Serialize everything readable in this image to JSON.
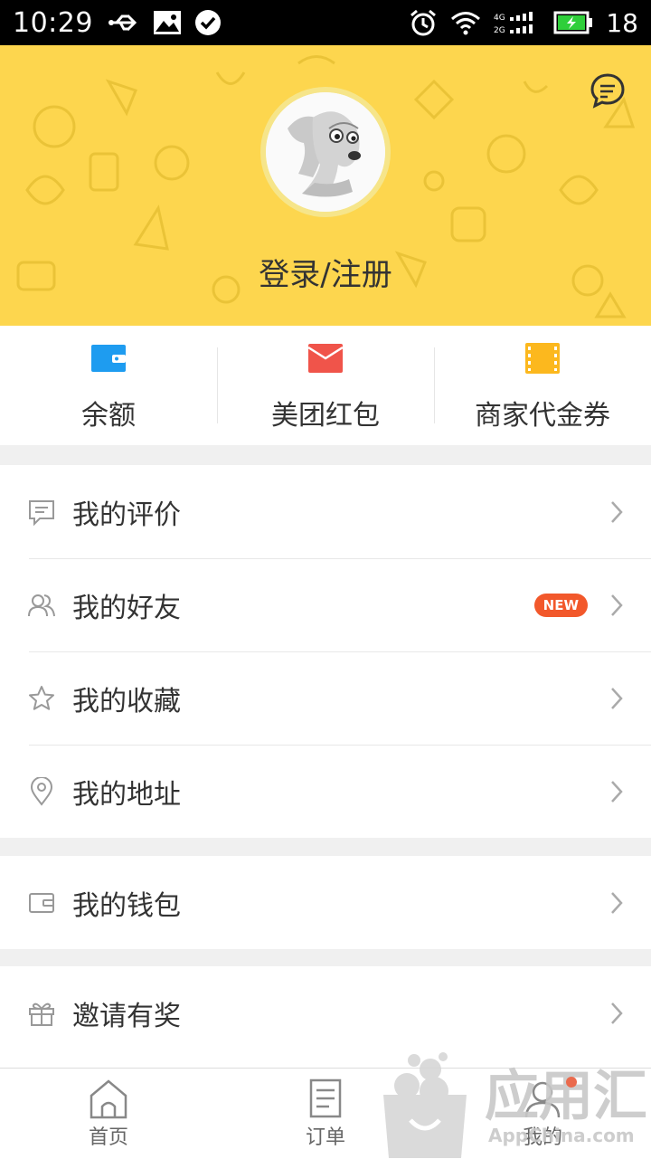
{
  "status_bar": {
    "time": "10:29",
    "battery_level": "18",
    "left_icons": [
      "usb-icon",
      "image-icon",
      "check-circle-icon"
    ],
    "right_icons": [
      "alarm-icon",
      "wifi-icon",
      "signal-icon",
      "battery-icon"
    ]
  },
  "header": {
    "login_label": "登录/注册",
    "background_color": "#fdd64e",
    "message_icon": "message-icon"
  },
  "quick_actions": [
    {
      "label": "余额",
      "icon": "wallet-icon",
      "color": "#1e9cf0"
    },
    {
      "label": "美团红包",
      "icon": "red-envelope-icon",
      "color": "#f0544a"
    },
    {
      "label": "商家代金券",
      "icon": "ticket-icon",
      "color": "#fcb81e"
    }
  ],
  "menu_groups": [
    {
      "items": [
        {
          "label": "我的评价",
          "icon": "comment-icon"
        },
        {
          "label": "我的好友",
          "icon": "friends-icon",
          "badge": "NEW"
        },
        {
          "label": "我的收藏",
          "icon": "star-icon"
        },
        {
          "label": "我的地址",
          "icon": "location-pin-icon"
        }
      ]
    },
    {
      "items": [
        {
          "label": "我的钱包",
          "icon": "wallet-outline-icon"
        }
      ]
    },
    {
      "items": [
        {
          "label": "邀请有奖",
          "icon": "gift-icon"
        }
      ]
    }
  ],
  "bottom_nav": {
    "items": [
      {
        "label": "首页",
        "icon": "home-icon"
      },
      {
        "label": "订单",
        "icon": "order-list-icon"
      },
      {
        "label": "我的",
        "icon": "profile-icon"
      }
    ]
  },
  "watermark": {
    "text": "应用汇",
    "url_text": "AppChina.com"
  }
}
